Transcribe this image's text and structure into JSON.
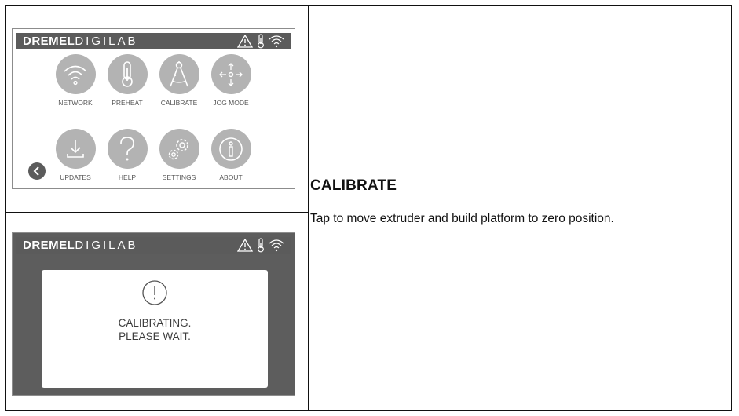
{
  "screen_top": {
    "logo_bold": "DREMEL",
    "logo_light": "DIGILAB",
    "status_icons": [
      "warning-icon",
      "thermometer-icon",
      "wifi-icon"
    ],
    "tiles": [
      {
        "label": "NETWORK",
        "icon": "wifi-icon"
      },
      {
        "label": "PREHEAT",
        "icon": "thermometer-icon"
      },
      {
        "label": "CALIBRATE",
        "icon": "compass-icon"
      },
      {
        "label": "JOG MODE",
        "icon": "move-arrows-icon"
      },
      {
        "label": "UPDATES",
        "icon": "download-icon"
      },
      {
        "label": "HELP",
        "icon": "question-icon"
      },
      {
        "label": "SETTINGS",
        "icon": "gears-icon"
      },
      {
        "label": "ABOUT",
        "icon": "info-icon"
      }
    ],
    "back_icon": "chevron-left-icon"
  },
  "screen_bottom": {
    "logo_bold": "DREMEL",
    "logo_light": "DIGILAB",
    "dialog_line1": "CALIBRATING.",
    "dialog_line2": "PLEASE WAIT."
  },
  "section": {
    "heading": "CALIBRATE",
    "body": "Tap to move extruder and build platform to zero position."
  },
  "colors": {
    "bar": "#5b5b5b",
    "tile": "#b3b3b3",
    "overlay": "#5d5d5d"
  }
}
